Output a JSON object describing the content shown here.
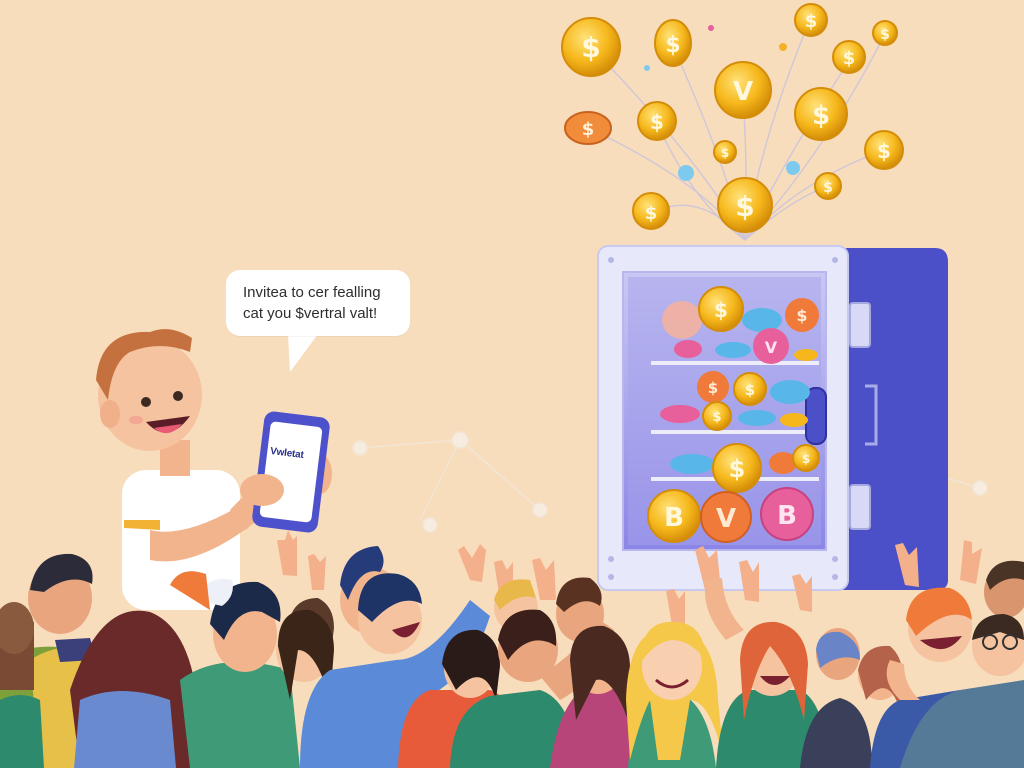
{
  "speech_bubble": {
    "line1": "Invitea to cer fealling",
    "line2": "cat you $vertral valt!"
  },
  "phone": {
    "screen_text": "Vwletat"
  },
  "colors": {
    "background": "#f8ddbd",
    "vault_body": "#4a4fc9",
    "vault_frame": "#e6e8fb",
    "coin_gold": "#f5b71c",
    "coin_orange": "#f07a3a",
    "coin_pink": "#e7609b",
    "coin_blue": "#58b7e8"
  },
  "icons": [
    "dollar-coin-icon",
    "bitcoin-coin-icon",
    "vault-coin-icon",
    "smartphone-icon",
    "vault-safe-icon"
  ]
}
